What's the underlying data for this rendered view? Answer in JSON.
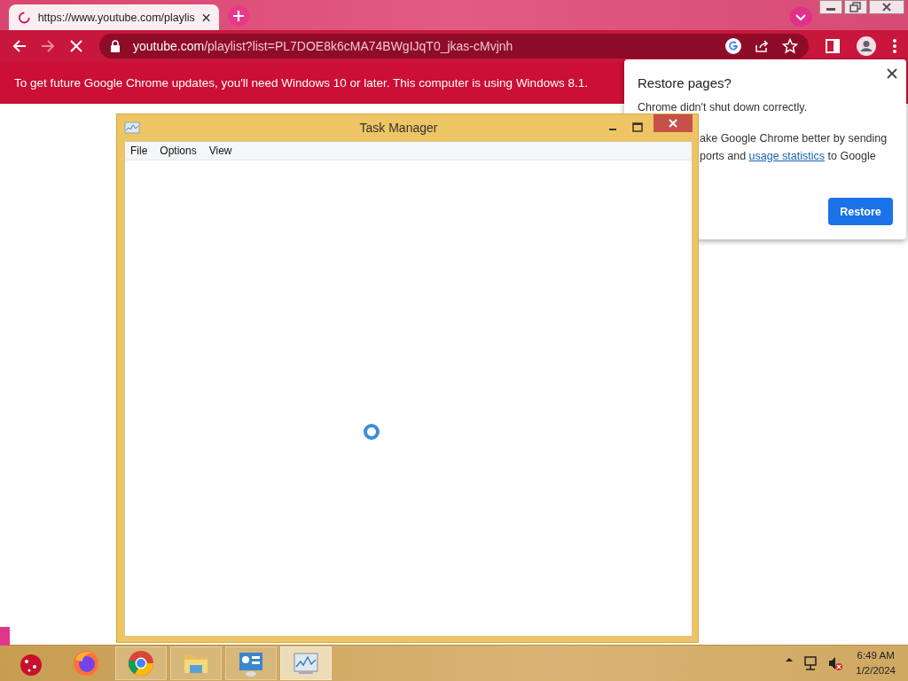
{
  "browser": {
    "tab": {
      "title": "https://www.youtube.com/playlis",
      "loading": true
    },
    "nav": [
      {
        "kind": "back",
        "disabled": false
      },
      {
        "kind": "forward",
        "disabled": true
      },
      {
        "kind": "stop",
        "disabled": false
      }
    ],
    "address": {
      "host": "youtube.com",
      "path": "/playlist?list=PL7DOE8k6cMA74BWgIJqT0_jkas-cMvjnh"
    },
    "infobar": "To get future Google Chrome updates, you'll need Windows 10 or later. This computer is using Windows 8.1."
  },
  "popup": {
    "title": "Restore pages?",
    "message": "Chrome didn't shut down correctly.",
    "line_2": "ake Google Chrome better by sending",
    "line_3": {
      "before": "ports and ",
      "link": "usage statistics",
      "after": " to Google"
    },
    "button": "Restore"
  },
  "task_manager": {
    "title": "Task Manager",
    "menu": [
      "File",
      "Options",
      "View"
    ],
    "loading": true
  },
  "taskbar": {
    "apps": [
      {
        "kind": "ornament",
        "running": false,
        "selected": false
      },
      {
        "kind": "firefox",
        "running": false,
        "selected": false
      },
      {
        "kind": "chrome",
        "running": true,
        "selected": false
      },
      {
        "kind": "explorer",
        "running": true,
        "selected": false
      },
      {
        "kind": "control",
        "running": true,
        "selected": false
      },
      {
        "kind": "taskmgr",
        "running": true,
        "selected": true
      }
    ],
    "tray": [
      {
        "kind": "caret"
      },
      {
        "kind": "network"
      },
      {
        "kind": "volume-muted"
      }
    ],
    "time": "6:49 AM",
    "date": "1/2/2024"
  }
}
